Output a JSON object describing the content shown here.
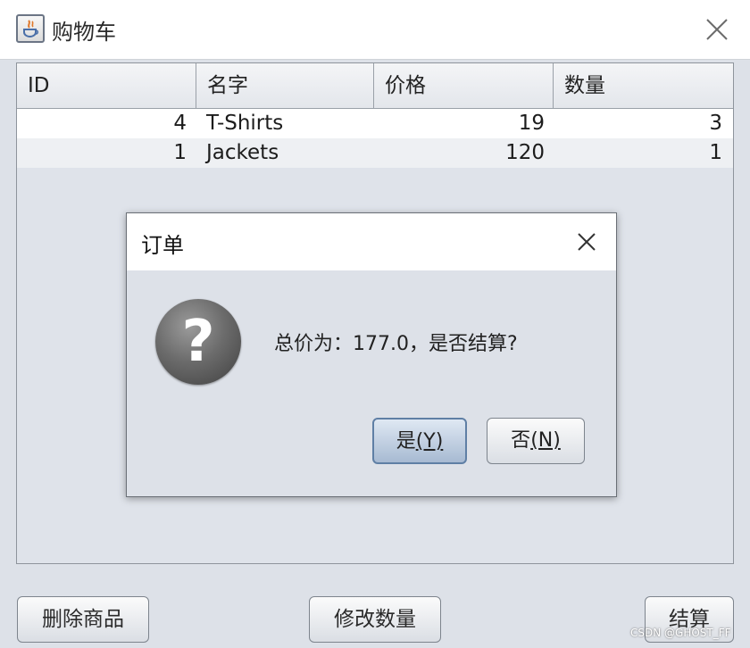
{
  "window": {
    "title": "购物车",
    "app_icon": "java-cup-icon",
    "close_icon": "close-icon"
  },
  "table": {
    "columns": [
      "ID",
      "名字",
      "价格",
      "数量"
    ],
    "rows": [
      {
        "id": "4",
        "name": "T-Shirts",
        "price": "19",
        "qty": "3"
      },
      {
        "id": "1",
        "name": "Jackets",
        "price": "120",
        "qty": "1"
      }
    ]
  },
  "buttons": {
    "delete": "删除商品",
    "modify": "修改数量",
    "checkout": "结算"
  },
  "dialog": {
    "title": "订单",
    "icon": "question-icon",
    "icon_glyph": "?",
    "message": "总价为：177.0，是否结算?",
    "yes_label": "是",
    "yes_mnemonic": "(Y)",
    "no_label": "否",
    "no_mnemonic": "(N)"
  },
  "watermark": "CSDN @GHOST_FF"
}
